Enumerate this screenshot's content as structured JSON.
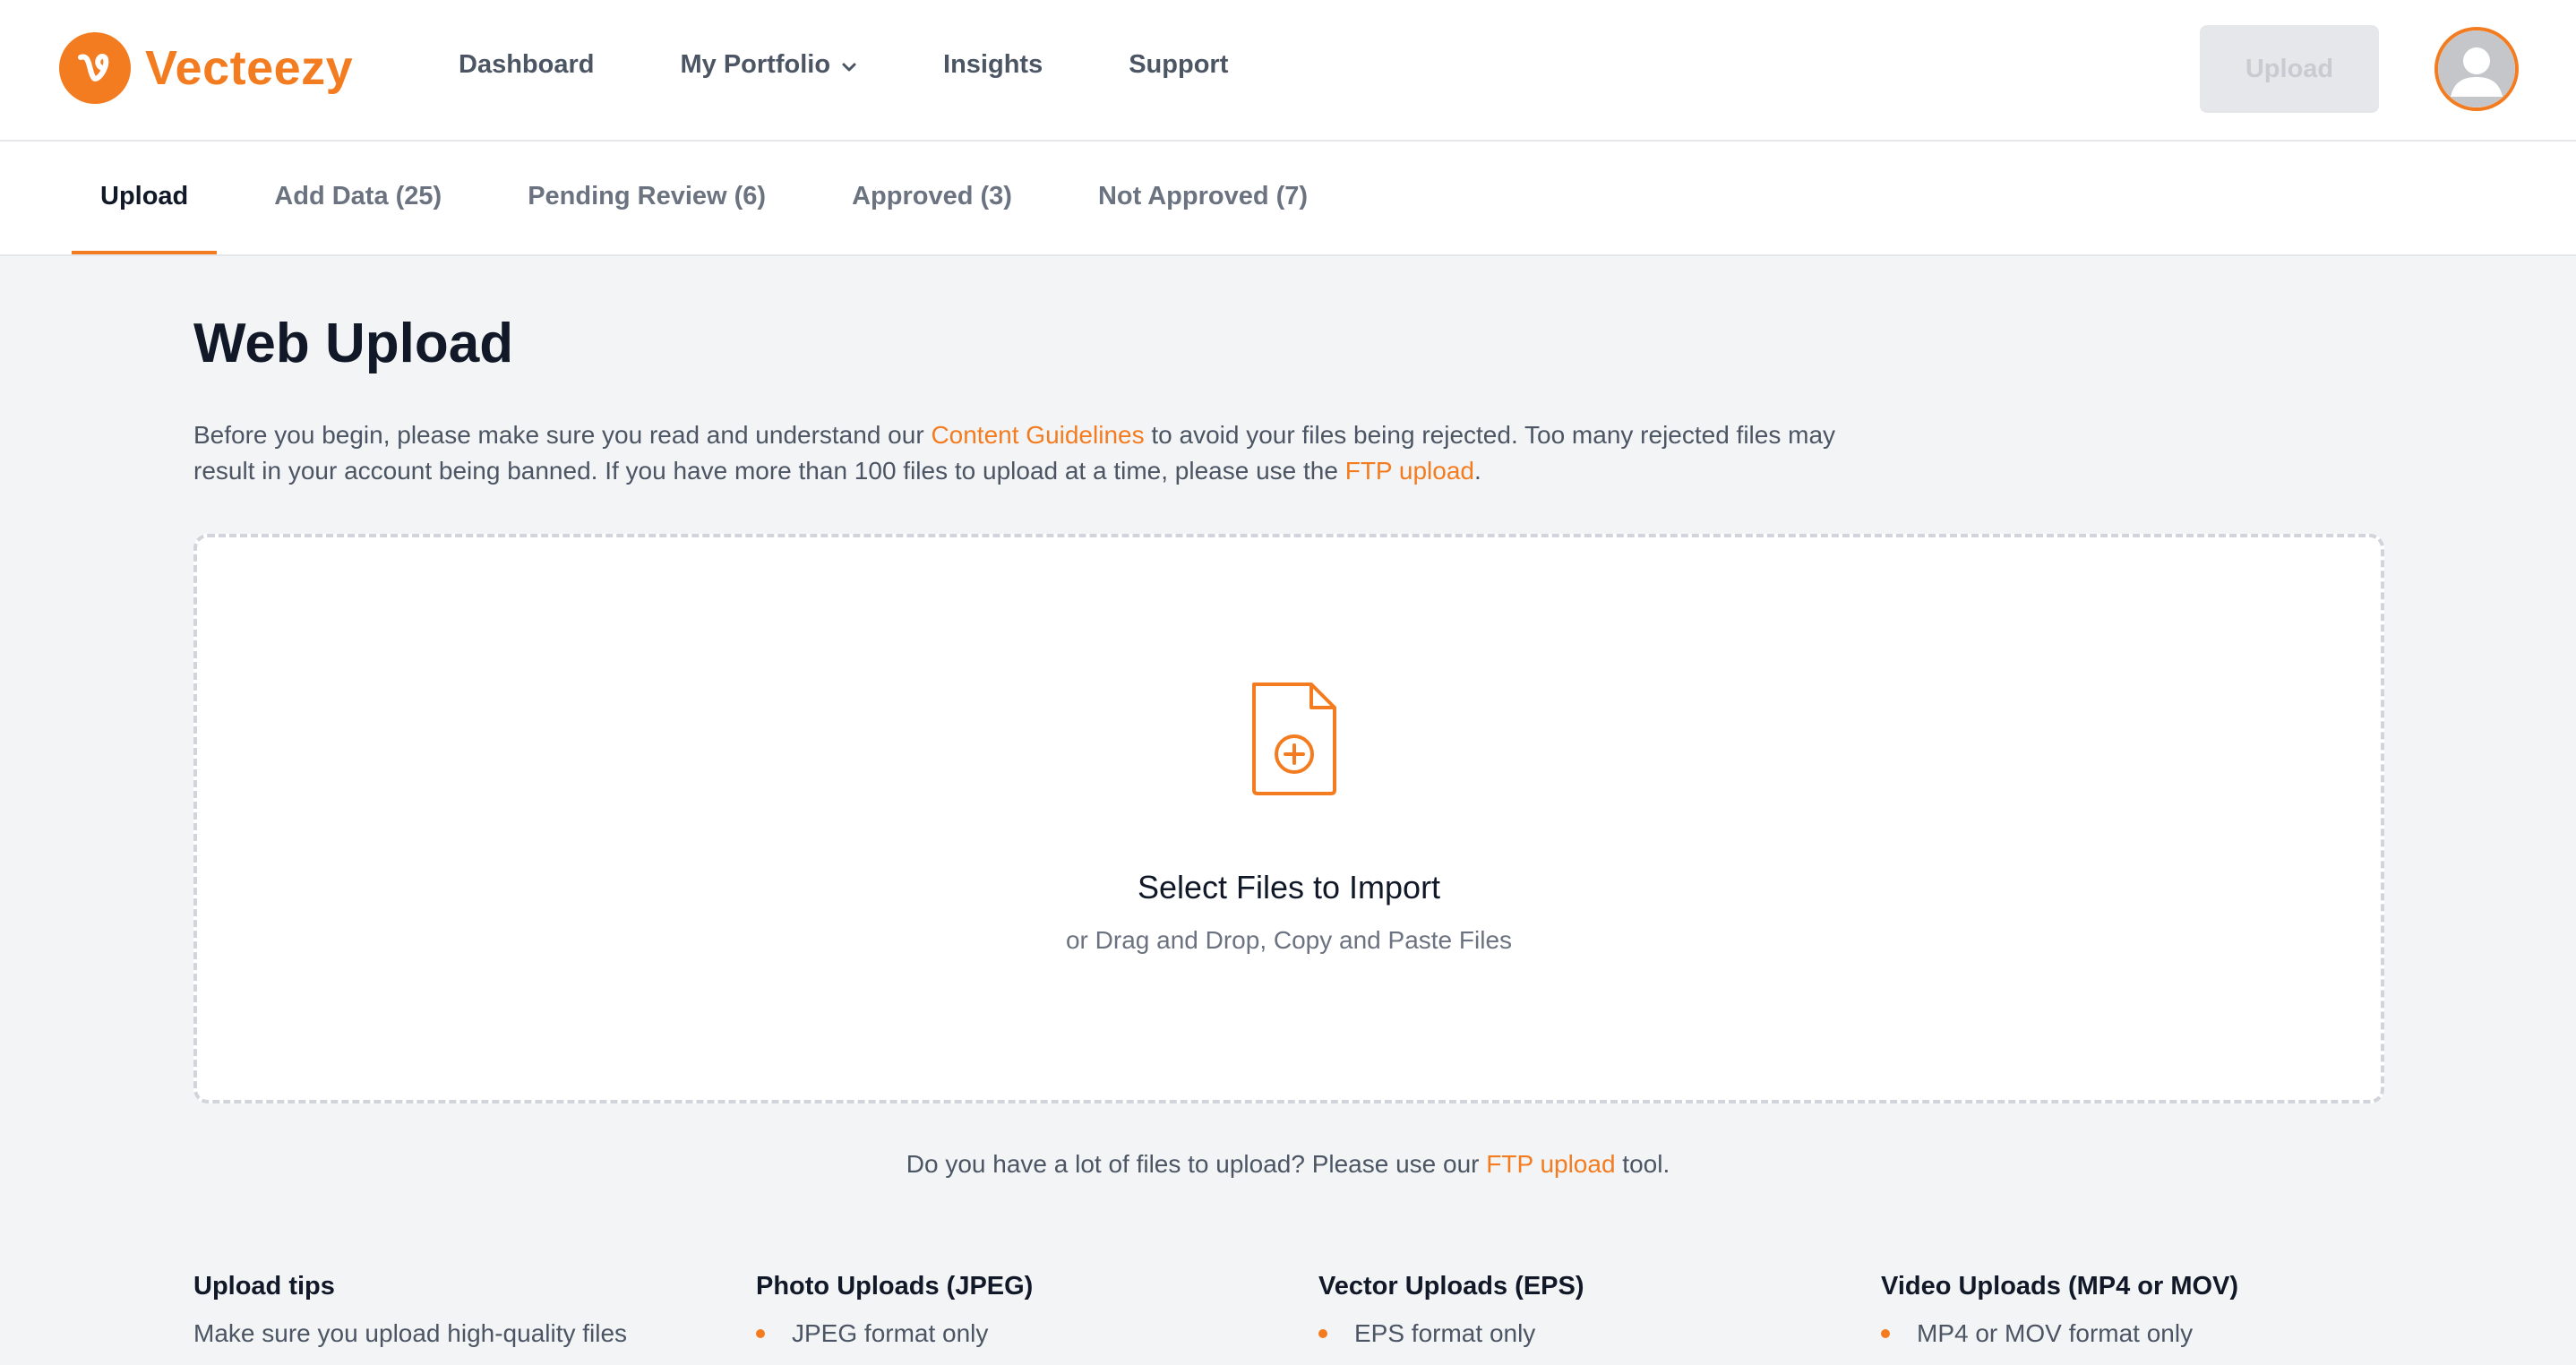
{
  "brand": {
    "name": "Vecteezy",
    "accent": "#f47c20"
  },
  "nav": {
    "items": [
      {
        "label": "Dashboard"
      },
      {
        "label": "My Portfolio",
        "has_dropdown": true
      },
      {
        "label": "Insights"
      },
      {
        "label": "Support"
      }
    ],
    "upload_label": "Upload",
    "avatar_icon": "user-avatar-icon"
  },
  "tabs": [
    {
      "label": "Upload",
      "active": true
    },
    {
      "label": "Add Data (25)"
    },
    {
      "label": "Pending Review (6)"
    },
    {
      "label": "Approved (3)"
    },
    {
      "label": "Not Approved (7)"
    }
  ],
  "page": {
    "title": "Web Upload",
    "intro": {
      "part1": "Before you begin, please make sure you read and understand our ",
      "link1": "Content Guidelines",
      "part2": " to avoid your files being rejected. Too many rejected files may result in your account being banned. If you have more than 100 files to upload at a time, please use the ",
      "link2": "FTP upload",
      "part3": "."
    }
  },
  "dropzone": {
    "icon": "file-add-icon",
    "title": "Select Files to Import",
    "subtitle": "or Drag and Drop, Copy and Paste Files"
  },
  "ftp_note": {
    "part1": "Do you have a lot of files to upload? Please use our ",
    "link": "FTP upload",
    "part2": " tool."
  },
  "tips": {
    "upload": {
      "title": "Upload tips",
      "text": "Make sure you upload high-quality files"
    },
    "photo": {
      "title": "Photo Uploads (JPEG)",
      "items": [
        "JPEG format only"
      ]
    },
    "vector": {
      "title": "Vector Uploads (EPS)",
      "items": [
        "EPS format only"
      ]
    },
    "video": {
      "title": "Video Uploads (MP4 or MOV)",
      "items": [
        "MP4 or MOV format only"
      ]
    }
  }
}
